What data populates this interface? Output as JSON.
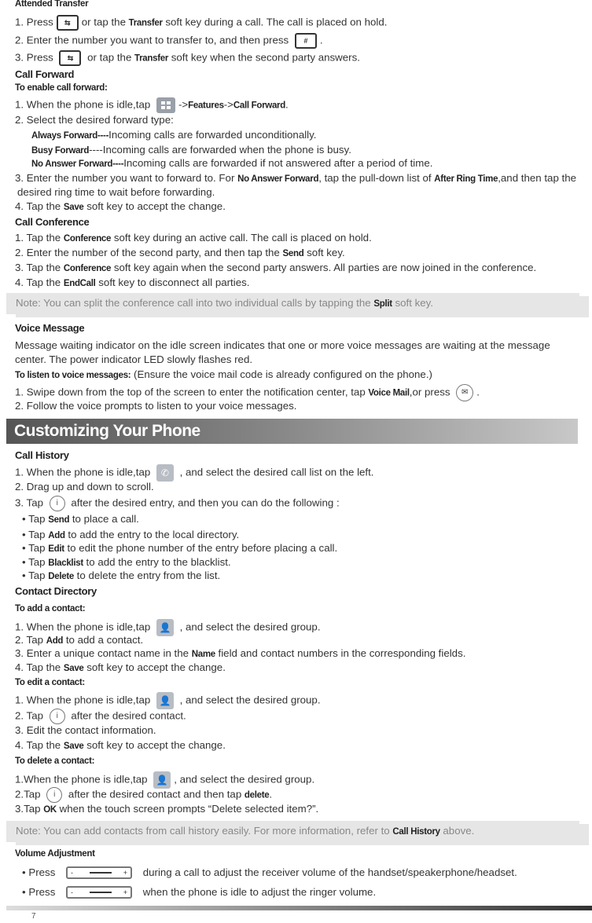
{
  "lines": [
    {
      "kind": "subheading",
      "s": [
        {
          "t": "Attended Transfer"
        }
      ]
    },
    {
      "s": [
        {
          "t": "1. Press"
        },
        {
          "icon": "transfer-key",
          "t": "⇆"
        },
        {
          "t": "or tap the "
        },
        {
          "t": "Transfer",
          "b": true
        },
        {
          "t": " soft key during a call. The call is placed on hold."
        }
      ]
    },
    {
      "s": [
        {
          "t": "2. Enter the number you want to transfer to, and then press "
        },
        {
          "icon": "send-key",
          "t": "#"
        },
        {
          "t": "."
        }
      ]
    },
    {
      "s": [
        {
          "t": "3. Press "
        },
        {
          "icon": "transfer-key",
          "t": "⇆"
        },
        {
          "t": " or tap the "
        },
        {
          "t": "Transfer",
          "b": true
        },
        {
          "t": " soft key when the second party answers."
        }
      ]
    },
    {
      "kind": "heading",
      "s": [
        {
          "t": "Call Forward"
        }
      ]
    },
    {
      "kind": "subheading",
      "s": [
        {
          "t": "To enable call forward:"
        }
      ]
    },
    {
      "s": [
        {
          "t": "1. When the phone is idle,tap "
        },
        {
          "icon": "menu-icon"
        },
        {
          "t": "->"
        },
        {
          "t": "Features",
          "b": true
        },
        {
          "t": "->"
        },
        {
          "t": "Call Forward",
          "b": true
        },
        {
          "t": "."
        }
      ]
    },
    {
      "s": [
        {
          "t": "2. Select the desired forward type:"
        }
      ]
    },
    {
      "indent": 1,
      "s": [
        {
          "t": "Always Forward----",
          "b": true
        },
        {
          "t": "Incoming calls are forwarded unconditionally."
        }
      ]
    },
    {
      "indent": 1,
      "s": [
        {
          "t": "Busy Forward",
          "b": true
        },
        {
          "t": "----Incoming calls are forwarded when the phone is busy."
        }
      ]
    },
    {
      "indent": 1,
      "s": [
        {
          "t": "No Answer Forward----",
          "b": true
        },
        {
          "t": "Incoming calls are forwarded if not answered after a period of time."
        }
      ]
    },
    {
      "s": [
        {
          "t": "3. Enter the number you want to forward to. For "
        },
        {
          "t": "No Answer Forward",
          "b": true
        },
        {
          "t": ", tap the pull-down list of "
        },
        {
          "t": "After Ring Time",
          "b": true
        },
        {
          "t": ",and then tap the"
        }
      ]
    },
    {
      "indent": 2,
      "s": [
        {
          "t": "desired ring time to wait before forwarding."
        }
      ]
    },
    {
      "s": [
        {
          "t": "4. Tap the "
        },
        {
          "t": "Save",
          "b": true
        },
        {
          "t": " soft key to accept the change."
        }
      ]
    },
    {
      "kind": "heading",
      "s": [
        {
          "t": "Call Conference"
        }
      ]
    },
    {
      "s": [
        {
          "t": "1. Tap the "
        },
        {
          "t": "Conference",
          "b": true
        },
        {
          "t": " soft key during an active call. The call is placed on hold."
        }
      ]
    },
    {
      "s": [
        {
          "t": "2. Enter the number of the second party, and then tap the "
        },
        {
          "t": "Send",
          "b": true
        },
        {
          "t": " soft key."
        }
      ]
    },
    {
      "s": [
        {
          "t": "3. Tap the "
        },
        {
          "t": "Conference",
          "b": true
        },
        {
          "t": " soft key again when the second party answers. All parties are now joined in the conference."
        }
      ]
    },
    {
      "s": [
        {
          "t": "4. Tap the "
        },
        {
          "t": "EndCall",
          "b": true
        },
        {
          "t": " soft key to disconnect all parties."
        }
      ]
    },
    {
      "kind": "note",
      "s": [
        {
          "t": "Note: You can split the conference call into two individual calls by tapping the "
        },
        {
          "t": "Split",
          "b": true
        },
        {
          "t": " soft key."
        }
      ]
    },
    {
      "kind": "heading",
      "s": [
        {
          "t": "Voice Message"
        }
      ]
    },
    {
      "s": [
        {
          "t": "Message waiting indicator on the idle screen indicates that one or more voice messages are waiting at the message"
        }
      ]
    },
    {
      "s": [
        {
          "t": "center. The power indicator LED slowly flashes red."
        }
      ]
    },
    {
      "s": [
        {
          "t": "To listen to voice messages:",
          "b": true
        },
        {
          "t": " (Ensure the voice mail code is already configured on the phone.)"
        }
      ]
    },
    {
      "s": [
        {
          "t": "1. Swipe down from the top of the screen to enter the notification center, tap "
        },
        {
          "t": "Voice Mail",
          "b": true
        },
        {
          "t": ",or press "
        },
        {
          "icon": "message-key",
          "t": "✉"
        },
        {
          "t": "."
        }
      ]
    },
    {
      "s": [
        {
          "t": "2. Follow the voice prompts to listen to your voice messages."
        }
      ]
    },
    {
      "kind": "heading",
      "s": [
        {
          "t": "Call History"
        }
      ]
    },
    {
      "s": [
        {
          "t": "1. When the phone is idle,tap "
        },
        {
          "icon": "call-history-icon",
          "t": "✆"
        },
        {
          "t": " , and select the desired call list on the left."
        }
      ]
    },
    {
      "s": [
        {
          "t": "2.  Drag up and down to scroll."
        }
      ]
    },
    {
      "s": [
        {
          "t": "3. Tap "
        },
        {
          "icon": "info-icon",
          "t": "i"
        },
        {
          "t": "  after the desired entry, and then you can do the following :"
        }
      ]
    },
    {
      "indent": 3,
      "s": [
        {
          "t": "•  Tap "
        },
        {
          "t": "Send",
          "b": true
        },
        {
          "t": " to place a call."
        }
      ]
    },
    {
      "indent": 3,
      "s": [
        {
          "t": "•  Tap "
        },
        {
          "t": "Add",
          "b": true
        },
        {
          "t": " to add the entry to the local directory."
        }
      ]
    },
    {
      "indent": 3,
      "s": [
        {
          "t": "•  Tap "
        },
        {
          "t": "Edit",
          "b": true
        },
        {
          "t": " to edit the phone number of the entry before placing a call."
        }
      ]
    },
    {
      "indent": 3,
      "s": [
        {
          "t": "•  Tap "
        },
        {
          "t": "Blacklist",
          "b": true
        },
        {
          "t": " to add the entry to the blacklist."
        }
      ]
    },
    {
      "indent": 3,
      "s": [
        {
          "t": "•  Tap "
        },
        {
          "t": "Delete",
          "b": true
        },
        {
          "t": " to delete the entry from the list."
        }
      ]
    },
    {
      "kind": "heading",
      "s": [
        {
          "t": "Contact Directory"
        }
      ]
    },
    {
      "kind": "subheading",
      "s": [
        {
          "t": "To add a contact:"
        }
      ]
    },
    {
      "s": [
        {
          "t": "1. When the phone is idle,tap "
        },
        {
          "icon": "contact-icon",
          "t": "👤"
        },
        {
          "t": " , and select the desired group."
        }
      ]
    },
    {
      "s": [
        {
          "t": "2. Tap "
        },
        {
          "t": "Add",
          "b": true
        },
        {
          "t": " to add a contact."
        }
      ]
    },
    {
      "s": [
        {
          "t": "3. Enter a unique contact name in the "
        },
        {
          "t": "Name",
          "b": true
        },
        {
          "t": " field and contact numbers in the corresponding fields."
        }
      ]
    },
    {
      "s": [
        {
          "t": "4. Tap the "
        },
        {
          "t": "Save",
          "b": true
        },
        {
          "t": " soft key to accept the change."
        }
      ]
    },
    {
      "kind": "subheading",
      "s": [
        {
          "t": "To edit a contact:"
        }
      ]
    },
    {
      "s": [
        {
          "t": "1. When the phone is idle,tap "
        },
        {
          "icon": "contact-icon",
          "t": "👤"
        },
        {
          "t": " , and select the desired group."
        }
      ]
    },
    {
      "s": [
        {
          "t": "2. Tap "
        },
        {
          "icon": "info-icon",
          "t": "i"
        },
        {
          "t": " after the desired contact."
        }
      ]
    },
    {
      "s": [
        {
          "t": "3. Edit the contact information."
        }
      ]
    },
    {
      "s": [
        {
          "t": "4. Tap the "
        },
        {
          "t": "Save",
          "b": true
        },
        {
          "t": " soft key to accept the change."
        }
      ]
    },
    {
      "kind": "subheading",
      "s": [
        {
          "t": "To delete a contact:"
        }
      ]
    },
    {
      "s": [
        {
          "t": "1.When the phone is idle,tap "
        },
        {
          "icon": "contact-icon",
          "t": "👤"
        },
        {
          "t": ", and select the desired group."
        }
      ]
    },
    {
      "s": [
        {
          "t": "2.Tap "
        },
        {
          "icon": "info-icon",
          "t": "i"
        },
        {
          "t": " after the desired contact and then tap "
        },
        {
          "t": "delete",
          "b": true
        },
        {
          "t": "."
        }
      ]
    },
    {
      "s": [
        {
          "t": "3.Tap "
        },
        {
          "t": "OK",
          "b": true
        },
        {
          "t": " when the touch screen prompts “Delete selected item?”."
        }
      ]
    },
    {
      "kind": "note",
      "s": [
        {
          "t": "Note: You can add contacts from call history easily. For more information, refer to "
        },
        {
          "t": "Call History",
          "b": true
        },
        {
          "t": " above."
        }
      ]
    },
    {
      "kind": "subheading",
      "s": [
        {
          "t": "Volume Adjustment"
        }
      ]
    },
    {
      "indent": 3,
      "s": [
        {
          "t": "• Press "
        },
        {
          "icon": "volume-key"
        },
        {
          "t": " during a call to adjust the receiver volume of the handset/speakerphone/headset."
        }
      ]
    },
    {
      "indent": 3,
      "s": [
        {
          "t": "• Press "
        },
        {
          "icon": "volume-key"
        },
        {
          "t": " when the phone is idle to adjust the ringer volume."
        }
      ]
    }
  ],
  "banner": "Customizing Your Phone",
  "page_number": "7"
}
